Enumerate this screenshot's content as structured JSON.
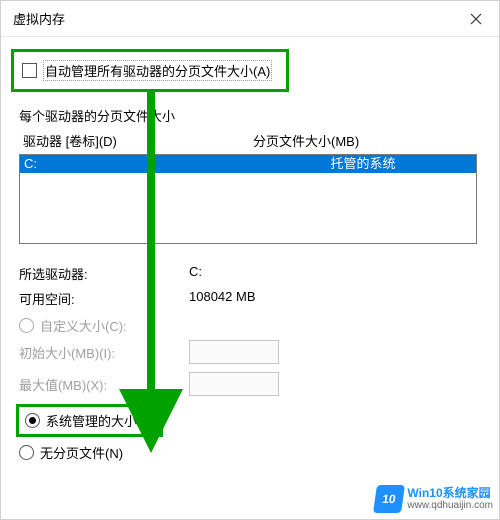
{
  "window": {
    "title": "虚拟内存"
  },
  "auto_manage": {
    "label": "自动管理所有驱动器的分页文件大小(A)"
  },
  "section_each_drive": "每个驱动器的分页文件大小",
  "table": {
    "col_drive": "驱动器  [卷标](D)",
    "col_size": "分页文件大小(MB)",
    "rows": [
      {
        "drive": "C:",
        "size": "托管的系统"
      }
    ]
  },
  "selected_drive": {
    "label": "所选驱动器:",
    "value": "C:"
  },
  "free_space": {
    "label": "可用空间:",
    "value": "108042 MB"
  },
  "custom_size": {
    "label": "自定义大小(C):"
  },
  "initial_size": {
    "label": "初始大小(MB)(I):"
  },
  "max_size": {
    "label": "最大值(MB)(X):"
  },
  "system_managed": {
    "label": "系统管理的大小(Y)"
  },
  "no_paging_file": {
    "label": "无分页文件(N)"
  },
  "watermark": {
    "badge": "10",
    "site_name": "Win10系统家园",
    "site_url": "www.qdhuaijin.com"
  }
}
